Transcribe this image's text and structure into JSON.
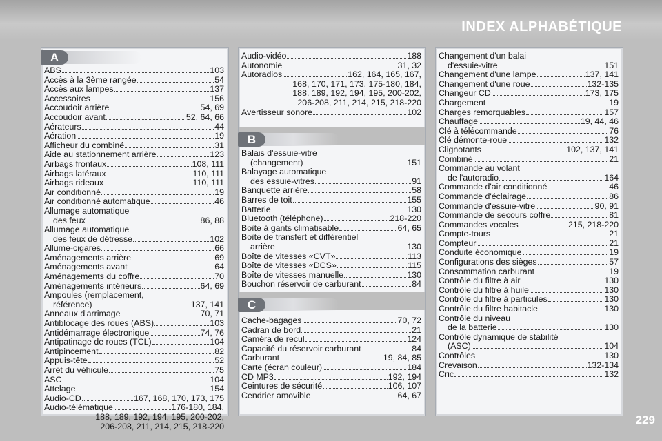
{
  "header": {
    "title": "INDEX ALPHABÉTIQUE"
  },
  "page_number": "229",
  "sections": {
    "A": {
      "letter": "A",
      "entries": [
        {
          "term": "ABS",
          "pages": "103"
        },
        {
          "term": "Accès à la 3ème rangée",
          "pages": "54"
        },
        {
          "term": "Accès aux lampes",
          "pages": "137"
        },
        {
          "term": "Accessoires",
          "pages": "156"
        },
        {
          "term": "Accoudoir arrière",
          "pages": "54, 69"
        },
        {
          "term": "Accoudoir avant",
          "pages": "52, 64, 66"
        },
        {
          "term": "Aérateurs",
          "pages": "44"
        },
        {
          "term": "Aération",
          "pages": "19"
        },
        {
          "term": "Afficheur du combiné",
          "pages": "31"
        },
        {
          "term": "Aide au stationnement arrière",
          "pages": "123"
        },
        {
          "term": "Airbags frontaux",
          "pages": "108, 111"
        },
        {
          "term": "Airbags latéraux",
          "pages": "110, 111"
        },
        {
          "term": "Airbags rideaux",
          "pages": "110, 111"
        },
        {
          "term": "Air conditionné",
          "pages": "19"
        },
        {
          "term": "Air conditionné automatique",
          "pages": "46"
        },
        {
          "term": "Allumage automatique"
        },
        {
          "term": "des feux",
          "pages": "86, 88",
          "indent": true
        },
        {
          "term": "Allumage automatique"
        },
        {
          "term": "des feux de détresse",
          "pages": "102",
          "indent": true
        },
        {
          "term": "Allume-cigares",
          "pages": "66"
        },
        {
          "term": "Aménagements arrière",
          "pages": "69"
        },
        {
          "term": "Aménagements avant",
          "pages": "64"
        },
        {
          "term": "Aménagements du coffre",
          "pages": "70"
        },
        {
          "term": "Aménagements intérieurs",
          "pages": "64, 69"
        },
        {
          "term": "Ampoules (remplacement,"
        },
        {
          "term": "référence)",
          "pages": "137, 141",
          "indent": true
        },
        {
          "term": "Anneaux d'arrimage",
          "pages": "70, 71"
        },
        {
          "term": "Antiblocage des roues (ABS)",
          "pages": "103"
        },
        {
          "term": "Antidémarrage électronique",
          "pages": "74, 76"
        },
        {
          "term": "Antipatinage de roues (TCL)",
          "pages": "104"
        },
        {
          "term": "Antipincement",
          "pages": "82"
        },
        {
          "term": "Appuis-tête",
          "pages": "52"
        },
        {
          "term": "Arrêt du véhicule",
          "pages": "75"
        },
        {
          "term": "ASC",
          "pages": "104"
        },
        {
          "term": "Attelage",
          "pages": "154"
        },
        {
          "term": "Audio-CD",
          "pages": "167, 168, 170, 173, 175"
        },
        {
          "term": "Audio-télématique",
          "pages": "176-180, 184,"
        },
        {
          "text": "188, 189, 192, 194, 195, 200-202,"
        },
        {
          "text": "206-208, 211, 214, 215, 218-220"
        }
      ]
    },
    "A_cont": {
      "entries": [
        {
          "term": "Audio-vidéo",
          "pages": "188"
        },
        {
          "term": "Autonomie",
          "pages": "31, 32"
        },
        {
          "term": "Autoradios",
          "pages": "162, 164, 165, 167,"
        },
        {
          "text": "168, 170, 171, 173, 175-180, 184,"
        },
        {
          "text": "188, 189, 192, 194, 195, 200-202,"
        },
        {
          "text": "206-208, 211, 214, 215, 218-220"
        },
        {
          "term": "Avertisseur sonore",
          "pages": "102"
        }
      ]
    },
    "B": {
      "letter": "B",
      "entries": [
        {
          "term": "Balais d'essuie-vitre"
        },
        {
          "term": "(changement)",
          "pages": "151",
          "indent": true
        },
        {
          "term": "Balayage automatique"
        },
        {
          "term": "des essuie-vitres",
          "pages": "91",
          "indent": true
        },
        {
          "term": "Banquette arrière",
          "pages": "58"
        },
        {
          "term": "Barres de toit",
          "pages": "155"
        },
        {
          "term": "Batterie",
          "pages": "130"
        },
        {
          "term": "Bluetooth (téléphone)",
          "pages": "218-220"
        },
        {
          "term": "Boîte à gants climatisable",
          "pages": "64, 65"
        },
        {
          "term": "Boîte de transfert et différentiel"
        },
        {
          "term": "arrière",
          "pages": "130",
          "indent": true
        },
        {
          "term": "Boîte de vitesses «CVT»",
          "pages": "113"
        },
        {
          "term": "Boîte de vitesses «DCS»",
          "pages": "115"
        },
        {
          "term": "Boîte de vitesses manuelle",
          "pages": "130"
        },
        {
          "term": "Bouchon réservoir de carburant",
          "pages": "84"
        }
      ]
    },
    "C": {
      "letter": "C",
      "entries": [
        {
          "term": "Cache-bagages",
          "pages": "70, 72"
        },
        {
          "term": "Cadran de bord",
          "pages": "21"
        },
        {
          "term": "Caméra de recul",
          "pages": "124"
        },
        {
          "term": "Capacité du réservoir carburant",
          "pages": "84"
        },
        {
          "term": "Carburant",
          "pages": "19, 84, 85"
        },
        {
          "term": "Carte (écran couleur)",
          "pages": "184"
        },
        {
          "term": "CD MP3",
          "pages": "192, 194"
        },
        {
          "term": "Ceintures de sécurité",
          "pages": "106, 107"
        },
        {
          "term": "Cendrier amovible",
          "pages": "64, 67"
        }
      ]
    },
    "C_cont": {
      "entries": [
        {
          "term": "Changement d'un balai"
        },
        {
          "term": "d'essuie-vitre",
          "pages": "151",
          "indent": true
        },
        {
          "term": "Changement d'une lampe",
          "pages": "137, 141"
        },
        {
          "term": "Changement d'une roue",
          "pages": "132-135"
        },
        {
          "term": "Changeur CD",
          "pages": "173, 175"
        },
        {
          "term": "Chargement",
          "pages": "19"
        },
        {
          "term": "Charges remorquables",
          "pages": "157"
        },
        {
          "term": "Chauffage",
          "pages": "19, 44, 46"
        },
        {
          "term": "Clé à télécommande",
          "pages": "76"
        },
        {
          "term": "Clé démonte-roue",
          "pages": "132"
        },
        {
          "term": "Clignotants",
          "pages": "102, 137, 141"
        },
        {
          "term": "Combiné",
          "pages": "21"
        },
        {
          "term": "Commande au volant"
        },
        {
          "term": "de l'autoradio",
          "pages": "164",
          "indent": true
        },
        {
          "term": "Commande d'air conditionné",
          "pages": "46"
        },
        {
          "term": "Commande d'éclairage",
          "pages": "86"
        },
        {
          "term": "Commande d'essuie-vitre",
          "pages": "90, 91"
        },
        {
          "term": "Commande de secours coffre",
          "pages": "81"
        },
        {
          "term": "Commandes vocales",
          "pages": "215, 218-220"
        },
        {
          "term": "Compte-tours",
          "pages": "21"
        },
        {
          "term": "Compteur",
          "pages": "21"
        },
        {
          "term": "Conduite économique",
          "pages": "19"
        },
        {
          "term": "Configurations des sièges",
          "pages": "57"
        },
        {
          "term": "Consommation carburant",
          "pages": "19"
        },
        {
          "term": "Contrôle du filtre à air",
          "pages": "130"
        },
        {
          "term": "Contrôle du filtre à huile",
          "pages": "130"
        },
        {
          "term": "Contrôle du filtre à particules",
          "pages": "130"
        },
        {
          "term": "Contrôle du filtre habitacle",
          "pages": "130"
        },
        {
          "term": "Contrôle du niveau"
        },
        {
          "term": "de la batterie",
          "pages": "130",
          "indent": true
        },
        {
          "term": "Contrôle dynamique de stabilité"
        },
        {
          "term": "(ASC)",
          "pages": "104",
          "indent": true
        },
        {
          "term": "Contrôles",
          "pages": "130"
        },
        {
          "term": "Crevaison",
          "pages": "132-134"
        },
        {
          "term": "Cric",
          "pages": "132"
        }
      ]
    }
  }
}
